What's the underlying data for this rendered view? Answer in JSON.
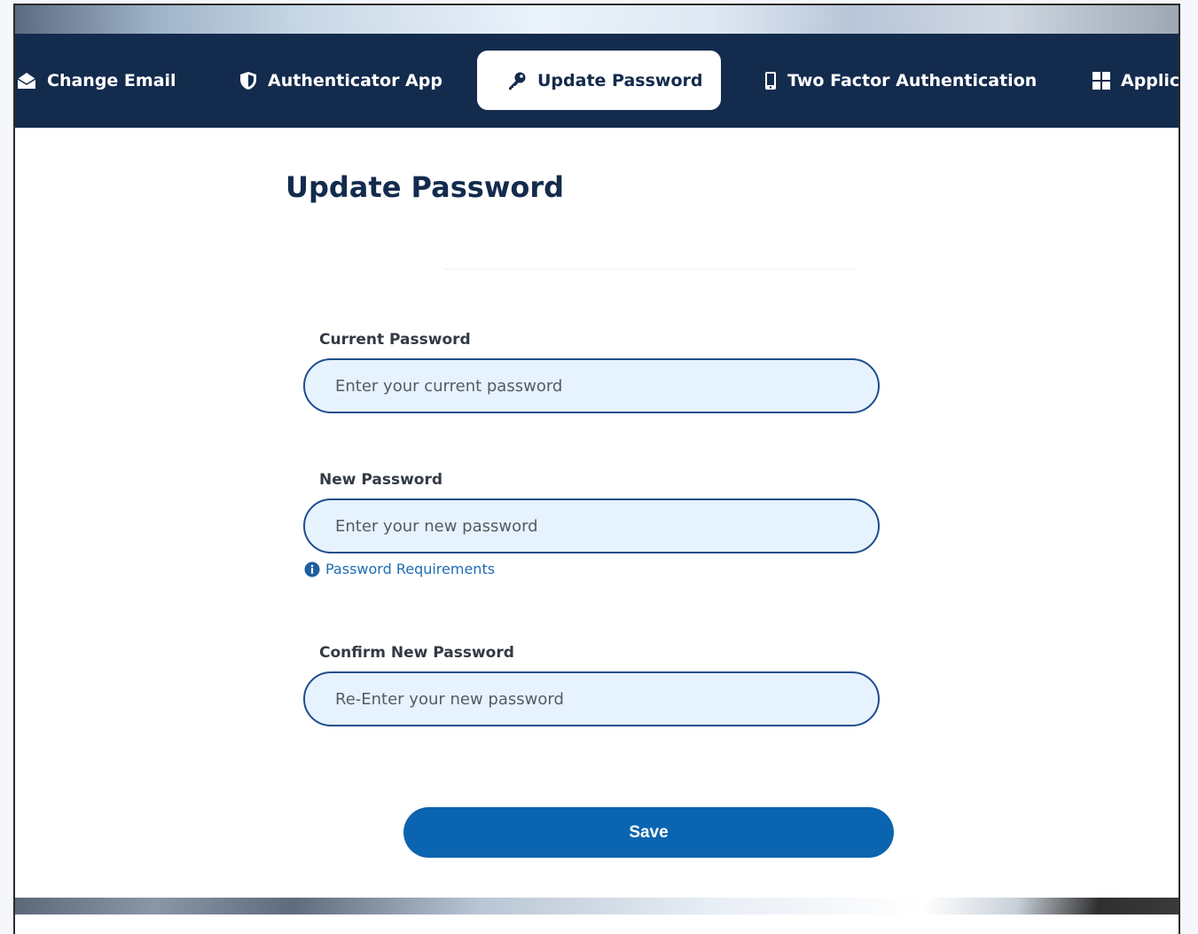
{
  "tabs": [
    {
      "label": "Change Email",
      "icon": "envelope-icon",
      "active": false
    },
    {
      "label": "Authenticator App",
      "icon": "shield-icon",
      "active": false
    },
    {
      "label": "Update Password",
      "icon": "key-icon",
      "active": true
    },
    {
      "label": "Two Factor Authentication",
      "icon": "mobile-icon",
      "active": false
    },
    {
      "label": "Applica",
      "icon": "grid-icon",
      "active": false
    }
  ],
  "page": {
    "title": "Update Password"
  },
  "form": {
    "current_password": {
      "label": "Current Password",
      "placeholder": "Enter your current password",
      "value": ""
    },
    "new_password": {
      "label": "New Password",
      "placeholder": "Enter your new password",
      "value": ""
    },
    "requirements_link": "Password Requirements",
    "confirm_password": {
      "label": "Confirm New Password",
      "placeholder": "Re-Enter your new password",
      "value": ""
    },
    "save_label": "Save"
  },
  "colors": {
    "nav_background": "#132b4d",
    "accent": "#0b64b0",
    "input_background": "#e6f2fd",
    "link": "#1f6db3"
  }
}
